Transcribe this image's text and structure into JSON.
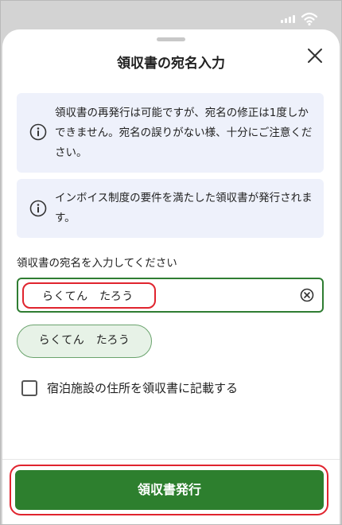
{
  "status_bar": {
    "signal_icon": "signal-icon",
    "wifi_icon": "wifi-icon"
  },
  "sheet": {
    "title": "領収書の宛名入力",
    "close_icon": "close-icon"
  },
  "notices": [
    {
      "icon": "info-icon",
      "text": "領収書の再発行は可能ですが、宛名の修正は1度しかできません。宛名の誤りがない様、十分にご注意ください。"
    },
    {
      "icon": "info-icon",
      "text": "インボイス制度の要件を満たした領収書が発行されます。"
    }
  ],
  "recipient": {
    "label": "領収書の宛名を入力してください",
    "value": "らくてん　たろう",
    "clear_icon": "clear-circle-icon",
    "suggestion": "らくてん　たろう"
  },
  "address_option": {
    "label": "宿泊施設の住所を領収書に記載する",
    "checked": false
  },
  "footer": {
    "issue_button": "領収書発行"
  },
  "colors": {
    "primary_green": "#2d7f2e",
    "highlight_red": "#e0242e",
    "notice_bg": "#eef1fb",
    "suggestion_bg": "#e7f2e7"
  }
}
